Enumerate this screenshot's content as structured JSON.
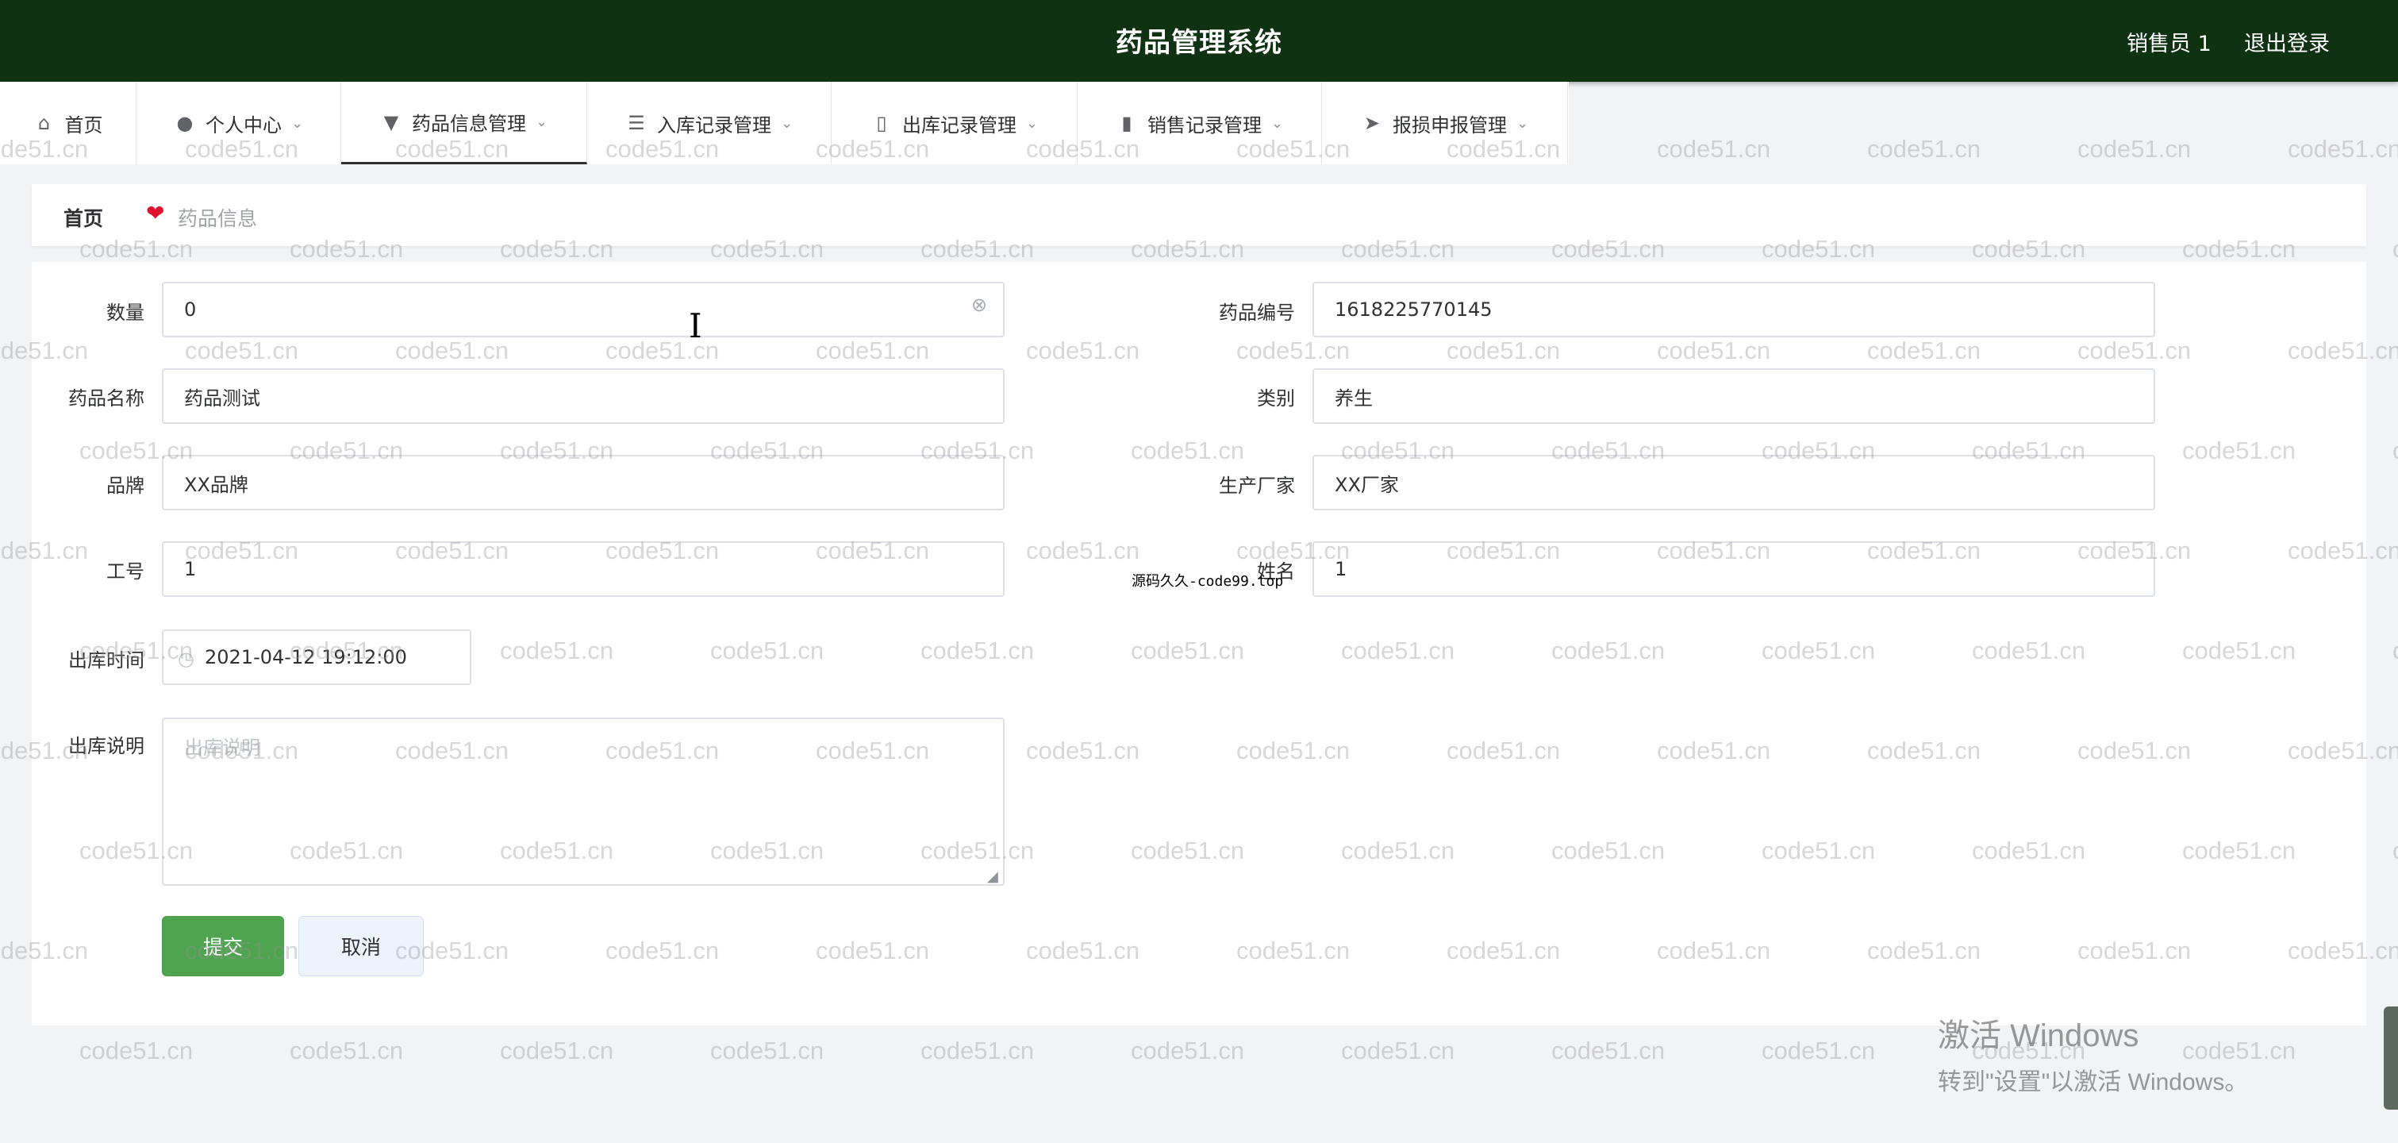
{
  "header": {
    "title": "药品管理系统",
    "user": "销售员 1",
    "logout": "退出登录"
  },
  "nav": {
    "items": [
      {
        "label": "首页",
        "icon": "home-icon",
        "dropdown": false
      },
      {
        "label": "个人中心",
        "icon": "user-icon",
        "dropdown": true
      },
      {
        "label": "药品信息管理",
        "icon": "bookmark-icon",
        "dropdown": true,
        "active": true
      },
      {
        "label": "入库记录管理",
        "icon": "list-icon",
        "dropdown": true
      },
      {
        "label": "出库记录管理",
        "icon": "mobile-icon",
        "dropdown": true
      },
      {
        "label": "销售记录管理",
        "icon": "chart-icon",
        "dropdown": true
      },
      {
        "label": "报损申报管理",
        "icon": "send-icon",
        "dropdown": true
      }
    ]
  },
  "breadcrumb": {
    "home": "首页",
    "current": "药品信息"
  },
  "form": {
    "quantity": {
      "label": "数量",
      "value": "0"
    },
    "drug_code": {
      "label": "药品编号",
      "value": "1618225770145"
    },
    "drug_name": {
      "label": "药品名称",
      "value": "药品测试"
    },
    "category": {
      "label": "类别",
      "value": "养生"
    },
    "brand": {
      "label": "品牌",
      "value": "XX品牌"
    },
    "manufacturer": {
      "label": "生产厂家",
      "value": "XX厂家"
    },
    "employee_id": {
      "label": "工号",
      "value": "1"
    },
    "name": {
      "label": "姓名",
      "value": "1"
    },
    "outbound_time": {
      "label": "出库时间",
      "value": "2021-04-12 19:12:00"
    },
    "outbound_note": {
      "label": "出库说明",
      "placeholder": "出库说明",
      "value": ""
    }
  },
  "buttons": {
    "submit": "提交",
    "cancel": "取消"
  },
  "overlay": {
    "code_stamp": "源码久久-code99.top",
    "watermark": "code51.cn",
    "windows_line1": "激活 Windows",
    "windows_line2": "转到\"设置\"以激活 Windows。"
  },
  "colors": {
    "header_bg": "#0f3212",
    "submit_bg": "#4ea44f",
    "cancel_bg": "#ecf3fb",
    "breadcrumb_heart": "#e0112e"
  }
}
